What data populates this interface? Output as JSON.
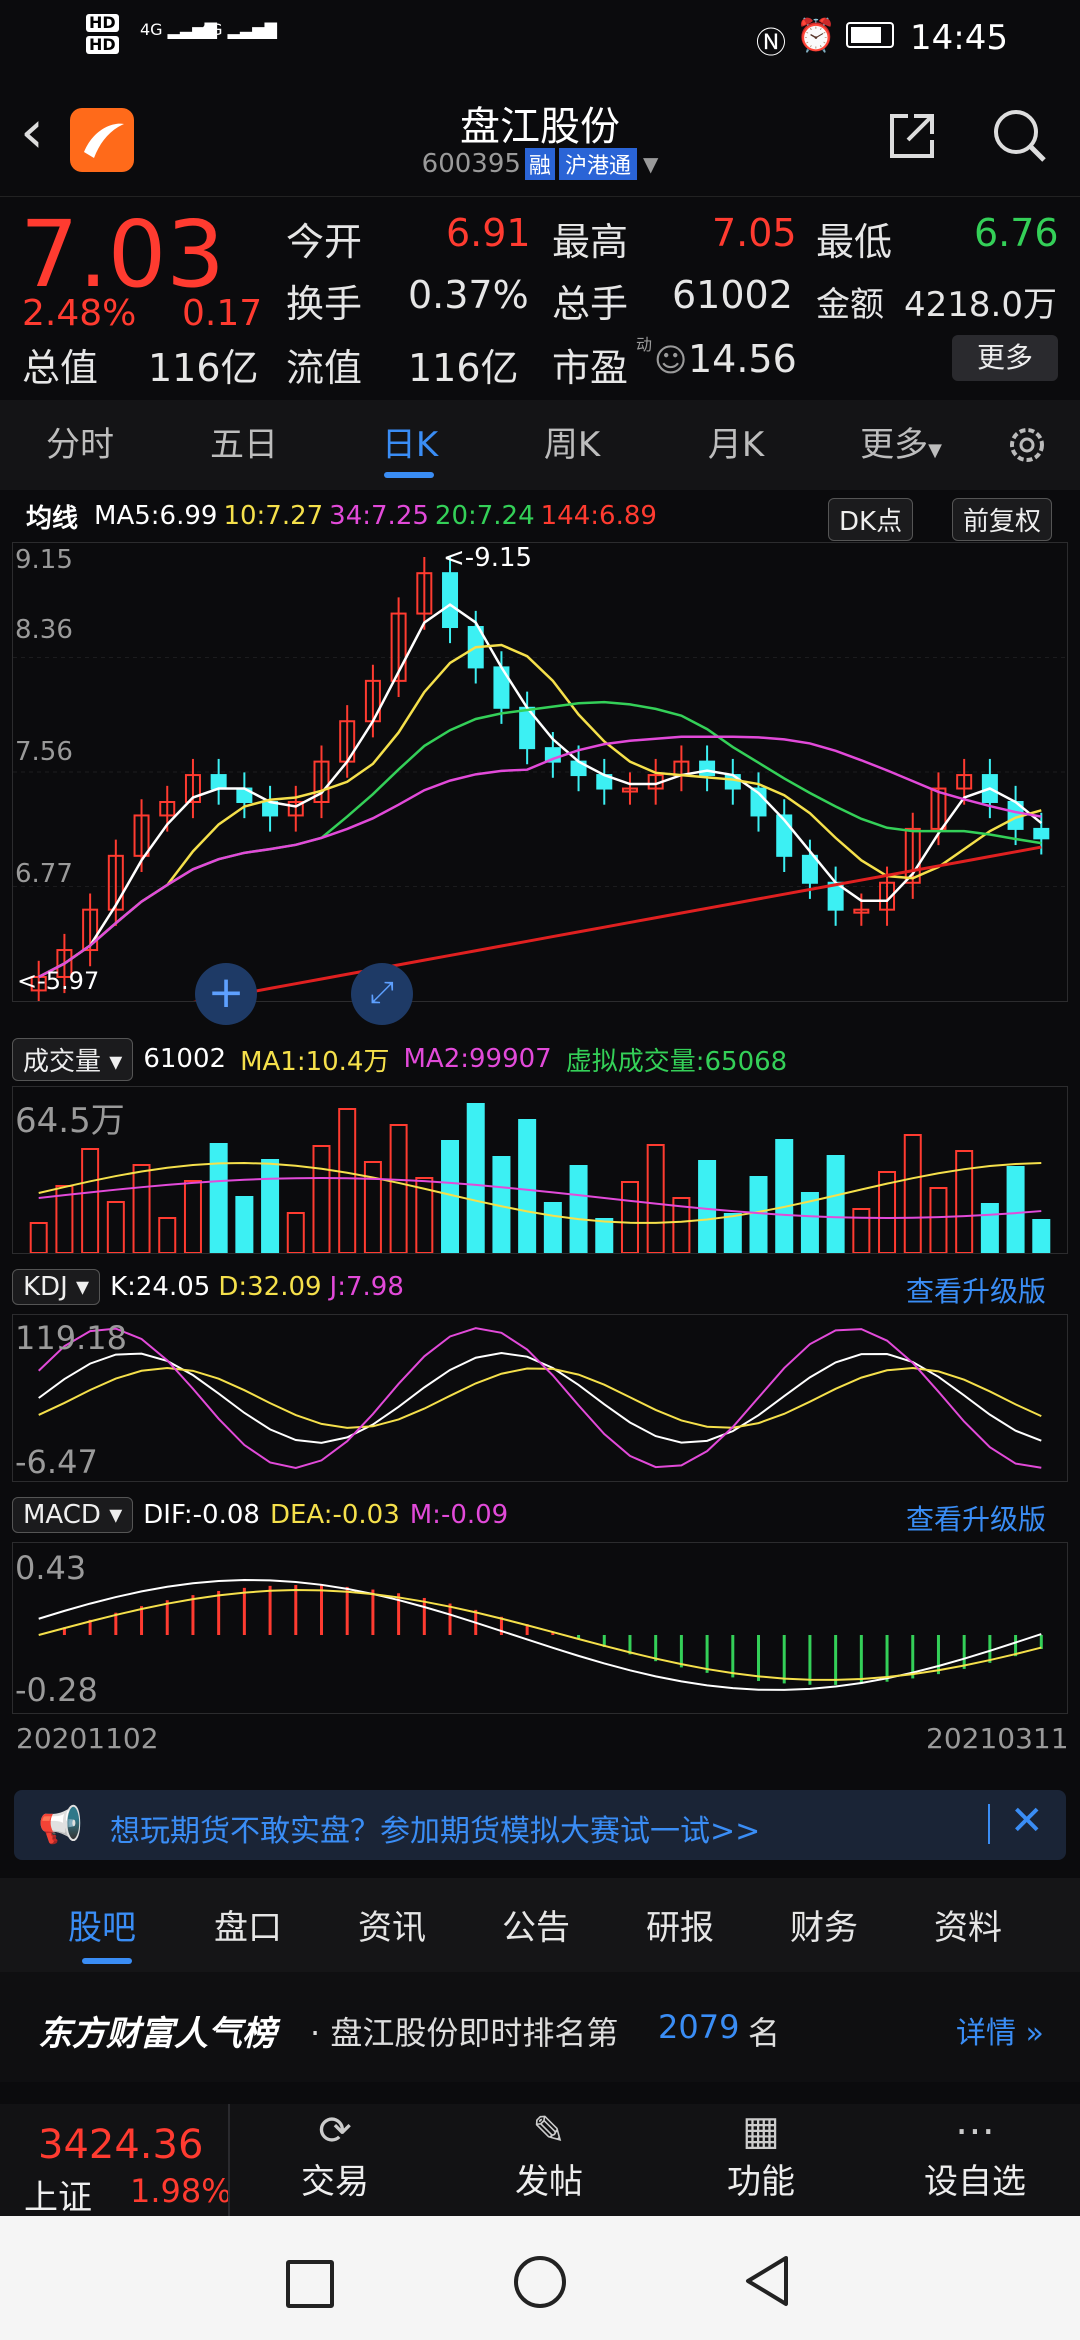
{
  "status_bar": {
    "net1": "HD",
    "net2": "HD",
    "sig1": "4G",
    "sig2": "4G",
    "time": "14:45"
  },
  "header": {
    "title": "盘江股份",
    "code": "600395",
    "badge_rong": "融",
    "badge_hgt": "沪港通"
  },
  "quote": {
    "price": "7.03",
    "change_pct": "2.48%",
    "change": "0.17",
    "open_label": "今开",
    "open": "6.91",
    "high_label": "最高",
    "high": "7.05",
    "low_label": "最低",
    "low": "6.76",
    "turnover_label": "换手",
    "turnover": "0.37%",
    "volume_label": "总手",
    "volume": "61002",
    "amount_label": "金额",
    "amount": "4218.0万",
    "mcap_label": "总值",
    "mcap": "116亿",
    "float_label": "流值",
    "float_cap": "116亿",
    "pe_label": "市盈",
    "pe_sup": "动",
    "pe": "14.56",
    "more_label": "更多"
  },
  "tabs": [
    "分时",
    "五日",
    "日K",
    "周K",
    "月K",
    "更多"
  ],
  "active_tab": "日K",
  "ma_bar": {
    "label": "均线",
    "ma5": "MA5:6.99",
    "ma10": "10:7.27",
    "ma34": "34:7.25",
    "ma20": "20:7.24",
    "ma144": "144:6.89",
    "dk": "DK点",
    "adjust": "前复权"
  },
  "kline": {
    "y_labels": [
      "9.15",
      "8.36",
      "7.56",
      "6.77"
    ],
    "max_note": "<-9.15",
    "min_note": "<-5.97"
  },
  "volume_bar": {
    "label": "成交量",
    "vol": "61002",
    "ma1": "MA1:10.4万",
    "ma2": "MA2:99907",
    "virtual": "虚拟成交量:65068",
    "y_label": "64.5万"
  },
  "kdj_bar": {
    "label": "KDJ",
    "k": "K:24.05",
    "d": "D:32.09",
    "j": "J:7.98",
    "upgrade": "查看升级版",
    "y_top": "119.18",
    "y_bot": "-6.47"
  },
  "macd_bar": {
    "label": "MACD",
    "dif": "DIF:-0.08",
    "dea": "DEA:-0.03",
    "m": "M:-0.09",
    "upgrade": "查看升级版",
    "y_top": "0.43",
    "y_bot": "-0.28"
  },
  "dates": {
    "start": "20201102",
    "end": "20210311"
  },
  "banner": {
    "text": "想玩期货不敢实盘？参加期货模拟大赛试一试>>"
  },
  "bottom_tabs": [
    "股吧",
    "盘口",
    "资讯",
    "公告",
    "研报",
    "财务",
    "资料"
  ],
  "rank": {
    "brand": "东方财富人气榜",
    "prefix": "· 盘江股份即时排名第",
    "num": "2079",
    "suffix": "名",
    "detail": "详情"
  },
  "footer": {
    "index_value": "3424.36",
    "index_name": "上证",
    "index_pct": "1.98%",
    "trade": "交易",
    "post": "发帖",
    "func": "功能",
    "watch": "设自选"
  },
  "chart_data": {
    "type": "candlestick",
    "x_start": "20201102",
    "x_end": "20210311",
    "y_range": [
      5.97,
      9.15
    ],
    "high": 9.15,
    "low": 5.97,
    "series_close": [
      6.0,
      6.2,
      6.5,
      6.9,
      7.2,
      7.3,
      7.5,
      7.4,
      7.3,
      7.2,
      7.3,
      7.6,
      7.9,
      8.2,
      8.7,
      9.0,
      8.6,
      8.3,
      8.0,
      7.7,
      7.6,
      7.5,
      7.4,
      7.4,
      7.5,
      7.6,
      7.5,
      7.4,
      7.2,
      6.9,
      6.7,
      6.5,
      6.5,
      6.7,
      7.1,
      7.4,
      7.5,
      7.3,
      7.1,
      7.03
    ]
  }
}
